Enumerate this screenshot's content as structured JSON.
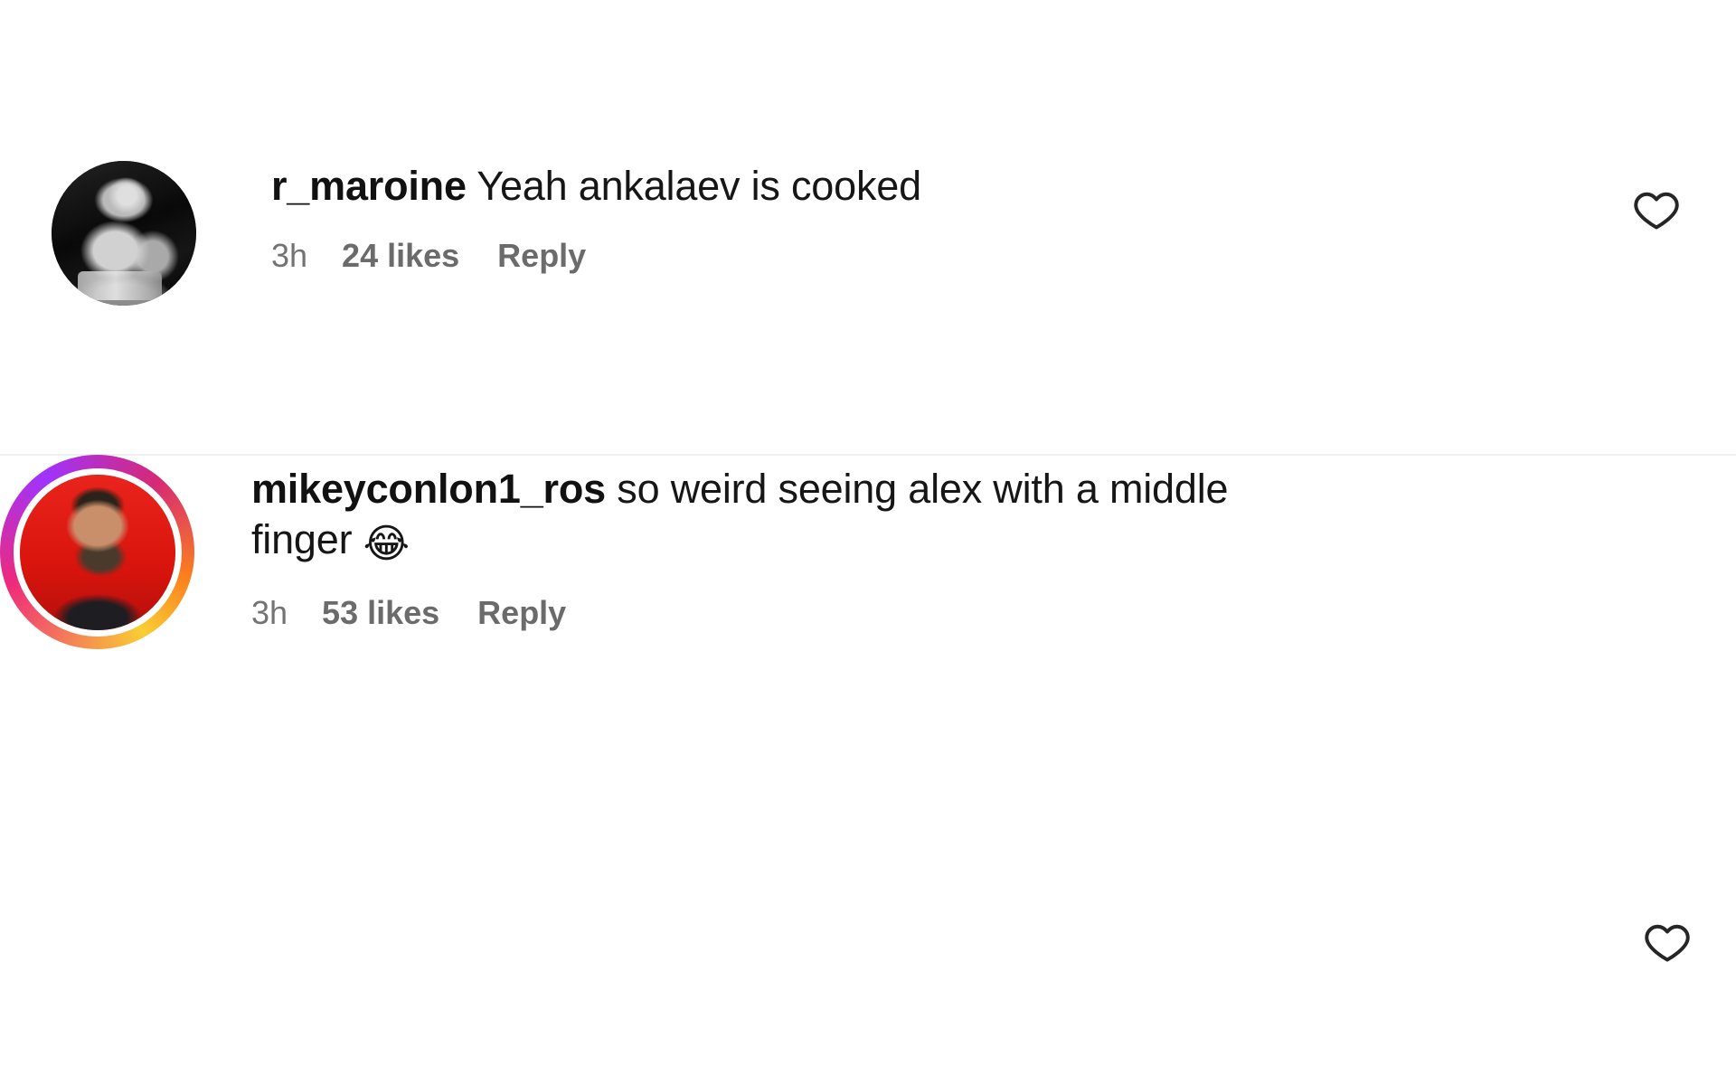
{
  "app": "instagram-comments",
  "colors": {
    "background": "#ffffff",
    "text": "#161616",
    "muted": "#737373",
    "divider": "#efefef",
    "ring_gradient_start": "#f9ce34",
    "ring_gradient_mid": "#ee2a7b",
    "ring_gradient_end": "#a033ff",
    "avatar_red": "#e51b14"
  },
  "comments": [
    {
      "id": "comment-1",
      "avatar": {
        "name": "avatar-r-maroine",
        "style": "grayscale-photo",
        "has_story_ring": false
      },
      "username": "r_maroine",
      "text": " Yeah ankalaev is cooked",
      "meta": {
        "time": "3h",
        "likes": "24 likes",
        "reply": "Reply"
      },
      "like_icon": "heart-outline-icon"
    },
    {
      "id": "comment-2",
      "avatar": {
        "name": "avatar-mikeyconlon1-ros",
        "style": "red-photo",
        "has_story_ring": true
      },
      "username": "mikeyconlon1_ros",
      "text": " so weird seeing alex with a middle finger ",
      "emoji": "😂",
      "meta": {
        "time": "3h",
        "likes": "53 likes",
        "reply": "Reply"
      },
      "like_icon": "heart-outline-icon"
    }
  ]
}
